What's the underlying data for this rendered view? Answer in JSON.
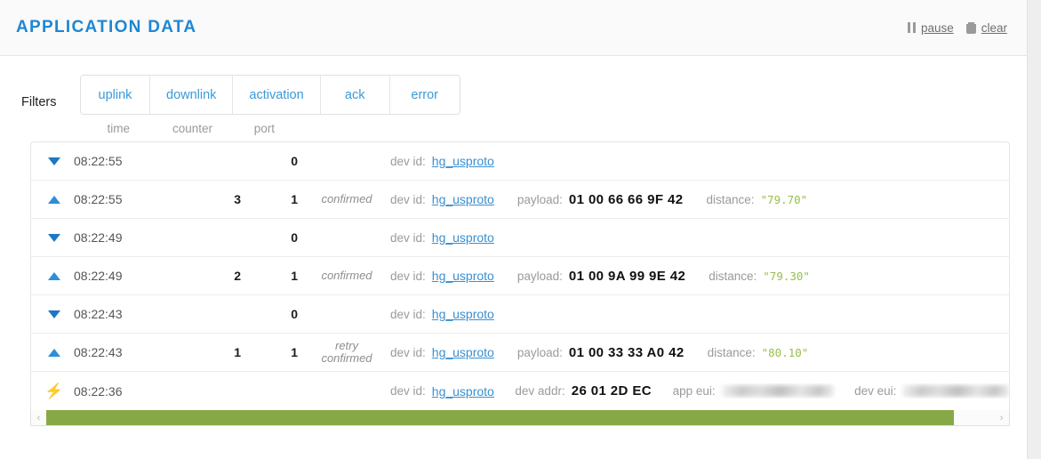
{
  "header": {
    "title": "APPLICATION DATA",
    "actions": [
      {
        "icon": "pause-icon",
        "label": "pause"
      },
      {
        "icon": "trash-icon",
        "label": "clear"
      }
    ]
  },
  "filters": {
    "label": "Filters",
    "buttons": [
      "uplink",
      "downlink",
      "activation",
      "ack",
      "error"
    ]
  },
  "table": {
    "columns": [
      "time",
      "counter",
      "port"
    ],
    "labels": {
      "dev_id": "dev id:",
      "payload": "payload:",
      "distance": "distance:",
      "dev_addr": "dev addr:",
      "app_eui": "app eui:",
      "dev_eui": "dev eui:"
    },
    "rows": [
      {
        "direction": "downlink",
        "icon": "triangle-down-icon",
        "time": "08:22:55",
        "counter": "",
        "port": "0",
        "confirmed": "",
        "dev_id": "hg_usproto",
        "payload": "",
        "distance": ""
      },
      {
        "direction": "uplink",
        "icon": "triangle-up-icon",
        "time": "08:22:55",
        "counter": "3",
        "port": "1",
        "confirmed": "confirmed",
        "dev_id": "hg_usproto",
        "payload": "01 00 66 66 9F 42",
        "distance": "\"79.70\""
      },
      {
        "direction": "downlink",
        "icon": "triangle-down-icon",
        "time": "08:22:49",
        "counter": "",
        "port": "0",
        "confirmed": "",
        "dev_id": "hg_usproto",
        "payload": "",
        "distance": ""
      },
      {
        "direction": "uplink",
        "icon": "triangle-up-icon",
        "time": "08:22:49",
        "counter": "2",
        "port": "1",
        "confirmed": "confirmed",
        "dev_id": "hg_usproto",
        "payload": "01 00 9A 99 9E 42",
        "distance": "\"79.30\""
      },
      {
        "direction": "downlink",
        "icon": "triangle-down-icon",
        "time": "08:22:43",
        "counter": "",
        "port": "0",
        "confirmed": "",
        "dev_id": "hg_usproto",
        "payload": "",
        "distance": ""
      },
      {
        "direction": "uplink",
        "icon": "triangle-up-icon",
        "time": "08:22:43",
        "counter": "1",
        "port": "1",
        "confirmed_line1": "retry",
        "confirmed_line2": "confirmed",
        "dev_id": "hg_usproto",
        "payload": "01 00 33 33 A0 42",
        "distance": "\"80.10\""
      }
    ],
    "activation_row": {
      "direction": "activation",
      "icon": "lightning-bolt-icon",
      "time": "08:22:36",
      "dev_id": "hg_usproto",
      "dev_addr": "26 01 2D EC",
      "app_eui": "",
      "dev_eui": ""
    }
  },
  "scrollbar": {
    "left_arrow": "‹",
    "right_arrow": "›"
  },
  "colors": {
    "accent_blue": "#1e87d4",
    "link_blue": "#3a8fd0",
    "green_value": "#96bf4a",
    "scroll_thumb": "#87a945",
    "bolt_yellow": "#f7c13c"
  }
}
